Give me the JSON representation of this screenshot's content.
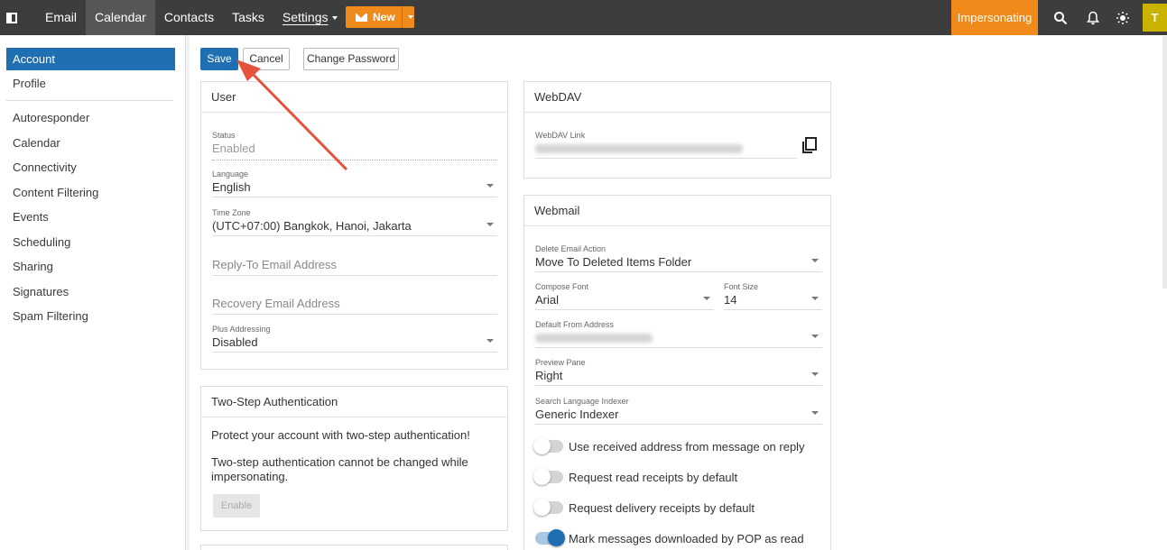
{
  "topbar": {
    "nav": [
      "Email",
      "Calendar",
      "Contacts",
      "Tasks",
      "Settings"
    ],
    "active_nav": "Calendar",
    "new_label": "New",
    "impersonating_label": "Impersonating",
    "avatar_initial": "T"
  },
  "sidebar": {
    "items": [
      "Account",
      "Profile",
      "Autoresponder",
      "Calendar",
      "Connectivity",
      "Content Filtering",
      "Events",
      "Scheduling",
      "Sharing",
      "Signatures",
      "Spam Filtering"
    ],
    "active": "Account"
  },
  "actions": {
    "save": "Save",
    "cancel": "Cancel",
    "change_password": "Change Password"
  },
  "user_card": {
    "title": "User",
    "status_label": "Status",
    "status_value": "Enabled",
    "language_label": "Language",
    "language_value": "English",
    "timezone_label": "Time Zone",
    "timezone_value": "(UTC+07:00) Bangkok, Hanoi, Jakarta",
    "reply_to_placeholder": "Reply-To Email Address",
    "recovery_placeholder": "Recovery Email Address",
    "plus_label": "Plus Addressing",
    "plus_value": "Disabled"
  },
  "twostep_card": {
    "title": "Two-Step Authentication",
    "line1": "Protect your account with two-step authentication!",
    "line2": "Two-step authentication cannot be changed while impersonating.",
    "enable": "Enable"
  },
  "webdav_card": {
    "title": "WebDAV",
    "link_label": "WebDAV Link"
  },
  "webmail_card": {
    "title": "Webmail",
    "delete_label": "Delete Email Action",
    "delete_value": "Move To Deleted Items Folder",
    "compose_font_label": "Compose Font",
    "compose_font_value": "Arial",
    "font_size_label": "Font Size",
    "font_size_value": "14",
    "from_label": "Default From Address",
    "preview_label": "Preview Pane",
    "preview_value": "Right",
    "indexer_label": "Search Language Indexer",
    "indexer_value": "Generic Indexer",
    "toggles": [
      {
        "label": "Use received address from message on reply",
        "on": false
      },
      {
        "label": "Request read receipts by default",
        "on": false
      },
      {
        "label": "Request delivery receipts by default",
        "on": false
      },
      {
        "label": "Mark messages downloaded by POP as read",
        "on": true
      }
    ]
  },
  "colors": {
    "topbar": "#3d3d3d",
    "accent_orange": "#f08a1b",
    "primary_blue": "#1f6fb2",
    "avatar": "#c9b200",
    "annotation_arrow": "#e5533d"
  }
}
